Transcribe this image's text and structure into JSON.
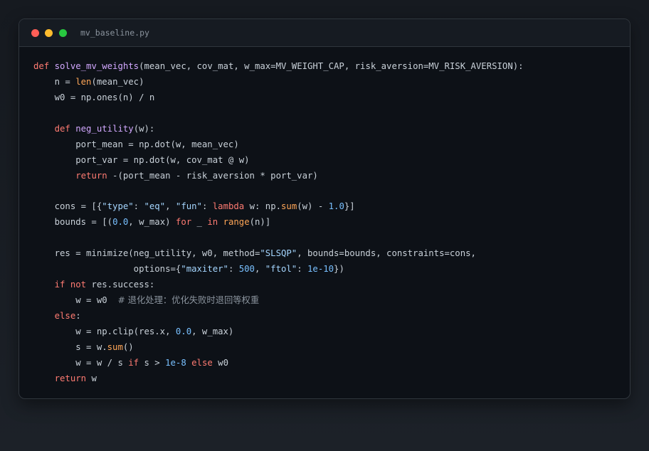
{
  "window": {
    "filename": "mv_baseline.py",
    "traffic_lights": {
      "close": "#ff5f57",
      "minimize": "#febc2e",
      "maximize": "#28c840"
    }
  },
  "theme": {
    "background": "#0d1117",
    "text": "#c9d1d9",
    "keyword": "#ff7b72",
    "function": "#d2a8ff",
    "builtin": "#ffa657",
    "string": "#a5d6ff",
    "number": "#79c0ff",
    "comment": "#8b949e"
  },
  "code_lines": [
    [
      [
        "kw",
        "def"
      ],
      [
        "p",
        " "
      ],
      [
        "fn",
        "solve_mv_weights"
      ],
      [
        "p",
        "(mean_vec, cov_mat, w_max=MV_WEIGHT_CAP, risk_aversion=MV_RISK_AVERSION):"
      ]
    ],
    [
      [
        "p",
        "    n = "
      ],
      [
        "bi",
        "len"
      ],
      [
        "p",
        "(mean_vec)"
      ]
    ],
    [
      [
        "p",
        "    w0 = np.ones(n) / n"
      ]
    ],
    [],
    [
      [
        "p",
        "    "
      ],
      [
        "kw",
        "def"
      ],
      [
        "p",
        " "
      ],
      [
        "fn",
        "neg_utility"
      ],
      [
        "p",
        "(w):"
      ]
    ],
    [
      [
        "p",
        "        port_mean = np.dot(w, mean_vec)"
      ]
    ],
    [
      [
        "p",
        "        port_var = np.dot(w, cov_mat @ w)"
      ]
    ],
    [
      [
        "p",
        "        "
      ],
      [
        "kw",
        "return"
      ],
      [
        "p",
        " -(port_mean - risk_aversion * port_var)"
      ]
    ],
    [],
    [
      [
        "p",
        "    cons = [{"
      ],
      [
        "str",
        "\"type\""
      ],
      [
        "p",
        ": "
      ],
      [
        "str",
        "\"eq\""
      ],
      [
        "p",
        ", "
      ],
      [
        "str",
        "\"fun\""
      ],
      [
        "p",
        ": "
      ],
      [
        "kw",
        "lambda"
      ],
      [
        "p",
        " w: np."
      ],
      [
        "bi",
        "sum"
      ],
      [
        "p",
        "(w) - "
      ],
      [
        "num",
        "1.0"
      ],
      [
        "p",
        "}]"
      ]
    ],
    [
      [
        "p",
        "    bounds = [("
      ],
      [
        "num",
        "0.0"
      ],
      [
        "p",
        ", w_max) "
      ],
      [
        "kw",
        "for"
      ],
      [
        "p",
        " _ "
      ],
      [
        "kw",
        "in"
      ],
      [
        "p",
        " "
      ],
      [
        "bi",
        "range"
      ],
      [
        "p",
        "(n)]"
      ]
    ],
    [],
    [
      [
        "p",
        "    res = minimize(neg_utility, w0, method="
      ],
      [
        "str",
        "\"SLSQP\""
      ],
      [
        "p",
        ", bounds=bounds, constraints=cons,"
      ]
    ],
    [
      [
        "p",
        "                   options={"
      ],
      [
        "str",
        "\"maxiter\""
      ],
      [
        "p",
        ": "
      ],
      [
        "num",
        "500"
      ],
      [
        "p",
        ", "
      ],
      [
        "str",
        "\"ftol\""
      ],
      [
        "p",
        ": "
      ],
      [
        "num",
        "1e-10"
      ],
      [
        "p",
        "})"
      ]
    ],
    [
      [
        "p",
        "    "
      ],
      [
        "kw",
        "if"
      ],
      [
        "p",
        " "
      ],
      [
        "kw",
        "not"
      ],
      [
        "p",
        " res.success:"
      ]
    ],
    [
      [
        "p",
        "        w = w0  "
      ],
      [
        "cm",
        "# 退化处理：优化失败时退回等权重"
      ]
    ],
    [
      [
        "p",
        "    "
      ],
      [
        "kw",
        "else"
      ],
      [
        "p",
        ":"
      ]
    ],
    [
      [
        "p",
        "        w = np.clip(res.x, "
      ],
      [
        "num",
        "0.0"
      ],
      [
        "p",
        ", w_max)"
      ]
    ],
    [
      [
        "p",
        "        s = w."
      ],
      [
        "bi",
        "sum"
      ],
      [
        "p",
        "()"
      ]
    ],
    [
      [
        "p",
        "        w = w / s "
      ],
      [
        "kw",
        "if"
      ],
      [
        "p",
        " s > "
      ],
      [
        "num",
        "1e-8"
      ],
      [
        "p",
        " "
      ],
      [
        "kw",
        "else"
      ],
      [
        "p",
        " w0"
      ]
    ],
    [
      [
        "p",
        "    "
      ],
      [
        "kw",
        "return"
      ],
      [
        "p",
        " w"
      ]
    ]
  ]
}
